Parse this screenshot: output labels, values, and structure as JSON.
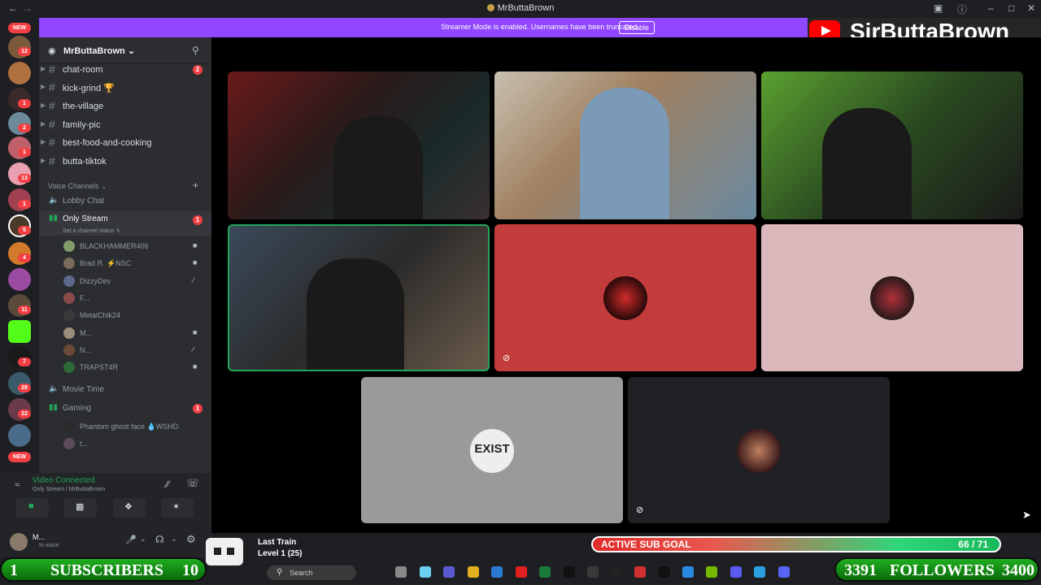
{
  "window": {
    "title": "MrButtaBrown"
  },
  "banner": {
    "message": "Streamer Mode is enabled. Usernames have been truncated.",
    "disable_label": "Disable"
  },
  "youtube_overlay": {
    "name": "SirButtaBrown"
  },
  "rail": {
    "new_top": "NEW",
    "new_bottom": "NEW",
    "badges": [
      "12",
      "1",
      "2",
      "1",
      "13",
      "1",
      "5",
      "4",
      "11",
      "1",
      "1",
      "7",
      "29",
      "22"
    ]
  },
  "server": {
    "name": "MrButtaBrown"
  },
  "text_channels": [
    {
      "label": "chat-room",
      "badge": "2"
    },
    {
      "label": "kick-grind 🏆",
      "badge": ""
    },
    {
      "label": "the-village",
      "badge": ""
    },
    {
      "label": "family-pic",
      "badge": ""
    },
    {
      "label": "best-food-and-cooking",
      "badge": ""
    },
    {
      "label": "butta-tiktok",
      "badge": ""
    }
  ],
  "voice_category": "Voice Channels",
  "voice_channels": {
    "lobby": "Lobby Chat",
    "only_stream": "Only Stream",
    "only_stream_badge": "1",
    "status_prompt": "Set a channel status",
    "movie": "Movie Time",
    "gaming": "Gaming",
    "gaming_badge": "1"
  },
  "only_stream_users": [
    {
      "name": "BLACKHAMMER406",
      "color": "#7f9c6a",
      "icon": "■"
    },
    {
      "name": "Brad R. ⚡NSC",
      "color": "#7a6b5c",
      "icon": "■"
    },
    {
      "name": "DizzyDev",
      "color": "#5b6a8c",
      "icon": "∕"
    },
    {
      "name": "F...",
      "color": "#8c4b4b",
      "icon": ""
    },
    {
      "name": "MetalChik24",
      "color": "#3a3a3a",
      "icon": ""
    },
    {
      "name": "M...",
      "color": "#9c8c7c",
      "icon": "■"
    },
    {
      "name": "N...",
      "color": "#6b4a3a",
      "icon": "∕"
    },
    {
      "name": "TRAPST4R",
      "color": "#2d6a3a",
      "icon": "■"
    }
  ],
  "gaming_users": [
    {
      "name": "Phantom ghost face 💧WSHD",
      "color": "#2a2a2a"
    },
    {
      "name": "t...",
      "color": "#5a4a5a"
    }
  ],
  "voice_panel": {
    "status": "Video Connected",
    "location": "Only Stream / MrButtaBrown"
  },
  "user_panel": {
    "name": "M...",
    "status": "In voice"
  },
  "stage": {
    "logo_text": "EXIST"
  },
  "sub_goal": {
    "label": "ACTIVE SUB GOAL",
    "value": "66 / 71",
    "current": 66,
    "target": 71
  },
  "subscribers": {
    "icon_number": "1",
    "label": "SUBSCRIBERS",
    "count": "10"
  },
  "followers": {
    "current": "3391",
    "label": "FOLLOWERS",
    "target": "3400"
  },
  "last_train": {
    "title": "Last Train",
    "level": "Level 1 (25)"
  },
  "taskbar": {
    "search_placeholder": "Search"
  },
  "colors": {
    "accent": "#9146ff",
    "discord_bg": "#2b2d31",
    "badge": "#f23f43",
    "speaking": "#23a55a"
  }
}
